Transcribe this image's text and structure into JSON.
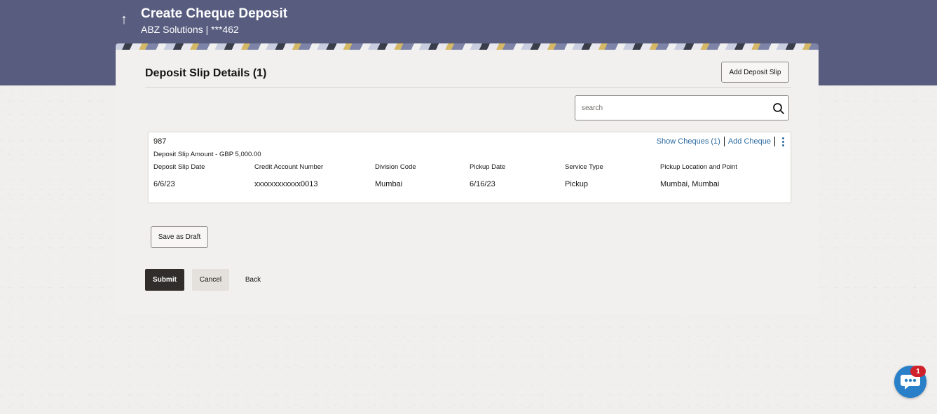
{
  "header": {
    "back_arrow": "↑",
    "title": "Create Cheque Deposit",
    "subtitle": "ABZ Solutions | ***462"
  },
  "section": {
    "title": "Deposit Slip Details (1)",
    "add_deposit_slip_label": "Add Deposit Slip"
  },
  "search": {
    "placeholder": "search"
  },
  "slip": {
    "number": "987",
    "amount_label": "Deposit Slip Amount - GBP 5,000.00",
    "show_cheques_label": "Show Cheques (1)",
    "add_cheque_label": "Add Cheque",
    "columns": [
      {
        "header": "Deposit Slip Date",
        "value": "6/6/23"
      },
      {
        "header": "Credit Account Number",
        "value": "xxxxxxxxxxxx0013"
      },
      {
        "header": "Division Code",
        "value": "Mumbai"
      },
      {
        "header": "Pickup Date",
        "value": "6/16/23"
      },
      {
        "header": "Service Type",
        "value": "Pickup"
      },
      {
        "header": "Pickup Location and Point",
        "value": "Mumbai, Mumbai"
      }
    ]
  },
  "actions": {
    "save_draft_label": "Save as Draft",
    "submit_label": "Submit",
    "cancel_label": "Cancel",
    "back_label": "Back"
  },
  "chat": {
    "badge_count": "1"
  },
  "colors": {
    "header_bg": "#585d80",
    "primary_button": "#312d2a",
    "link": "#2b6a9f",
    "chat_fab": "#2a7fc9",
    "badge": "#d0202a"
  }
}
